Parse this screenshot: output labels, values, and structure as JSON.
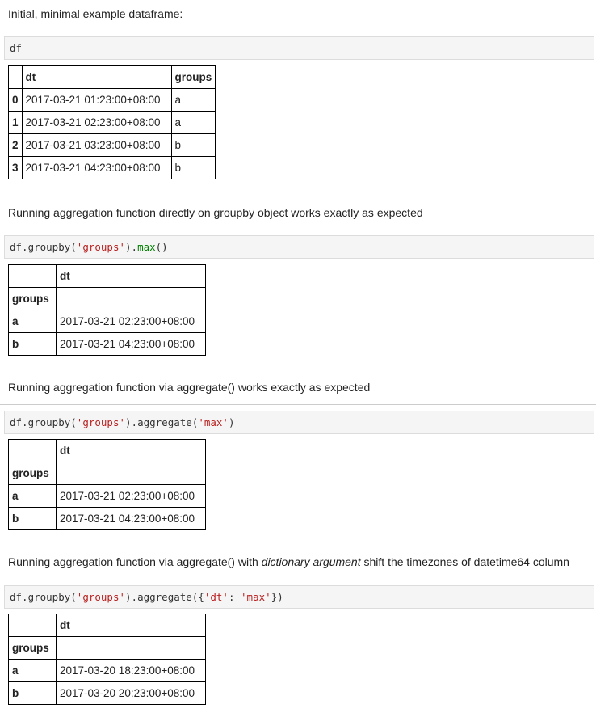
{
  "section1": {
    "intro": "Initial, minimal example dataframe:",
    "code": "df",
    "table": {
      "headers": [
        "",
        "dt",
        "groups"
      ],
      "rows": [
        [
          "0",
          "2017-03-21 01:23:00+08:00",
          "a"
        ],
        [
          "1",
          "2017-03-21 02:23:00+08:00",
          "a"
        ],
        [
          "2",
          "2017-03-21 03:23:00+08:00",
          "b"
        ],
        [
          "3",
          "2017-03-21 04:23:00+08:00",
          "b"
        ]
      ]
    }
  },
  "section2": {
    "text": "Running aggregation function directly on groupby object works exactly as expected",
    "code": {
      "p1": "df.groupby(",
      "s1": "'groups'",
      "p2": ").",
      "p3": "max",
      "p4": "()"
    },
    "table": {
      "col": "dt",
      "index_name": "groups",
      "rows": [
        [
          "a",
          "2017-03-21 02:23:00+08:00"
        ],
        [
          "b",
          "2017-03-21 04:23:00+08:00"
        ]
      ]
    }
  },
  "section3": {
    "text": "Running aggregation function via aggregate() works exactly as expected",
    "code": {
      "p1": "df.groupby(",
      "s1": "'groups'",
      "p2": ").aggregate(",
      "s2": "'max'",
      "p3": ")"
    },
    "table": {
      "col": "dt",
      "index_name": "groups",
      "rows": [
        [
          "a",
          "2017-03-21 02:23:00+08:00"
        ],
        [
          "b",
          "2017-03-21 04:23:00+08:00"
        ]
      ]
    }
  },
  "section4": {
    "text_pre": "Running aggregation function via aggregate() with ",
    "text_em": "dictionary argument",
    "text_post": " shift the timezones of datetime64 column",
    "code": {
      "p1": "df.groupby(",
      "s1": "'groups'",
      "p2": ").aggregate({",
      "s2": "'dt'",
      "p3": ": ",
      "s3": "'max'",
      "p4": "})"
    },
    "table": {
      "col": "dt",
      "index_name": "groups",
      "rows": [
        [
          "a",
          "2017-03-20 18:23:00+08:00"
        ],
        [
          "b",
          "2017-03-20 20:23:00+08:00"
        ]
      ]
    }
  }
}
